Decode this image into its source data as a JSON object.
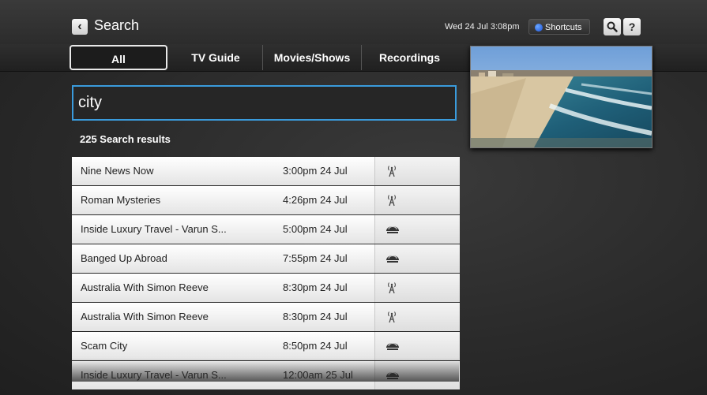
{
  "header": {
    "title": "Search",
    "datetime": "Wed 24 Jul 3:08pm",
    "shortcuts_label": "Shortcuts",
    "help_label": "?"
  },
  "tabs": [
    {
      "label": "All",
      "active": true
    },
    {
      "label": "TV Guide",
      "active": false
    },
    {
      "label": "Movies/Shows",
      "active": false
    },
    {
      "label": "Recordings",
      "active": false
    }
  ],
  "search": {
    "value": "city",
    "result_count": "225 Search results"
  },
  "results": [
    {
      "title": "Nine News Now",
      "time": "3:00pm 24 Jul",
      "source_icon": "antenna-icon"
    },
    {
      "title": "Roman Mysteries",
      "time": "4:26pm 24 Jul",
      "source_icon": "antenna-icon"
    },
    {
      "title": "Inside Luxury Travel - Varun S...",
      "time": "5:00pm 24 Jul",
      "source_icon": "satellite-dish-icon"
    },
    {
      "title": "Banged Up Abroad",
      "time": "7:55pm 24 Jul",
      "source_icon": "satellite-dish-icon"
    },
    {
      "title": "Australia With Simon Reeve",
      "time": "8:30pm 24 Jul",
      "source_icon": "antenna-icon"
    },
    {
      "title": "Australia With Simon Reeve",
      "time": "8:30pm 24 Jul",
      "source_icon": "antenna-icon"
    },
    {
      "title": "Scam City",
      "time": "8:50pm 24 Jul",
      "source_icon": "satellite-dish-icon"
    },
    {
      "title": "Inside Luxury Travel - Varun S...",
      "time": "12:00am 25 Jul",
      "source_icon": "satellite-dish-icon"
    }
  ],
  "colors": {
    "accent": "#3a9bdc",
    "shortcut_dot": "#1a4fd6"
  }
}
